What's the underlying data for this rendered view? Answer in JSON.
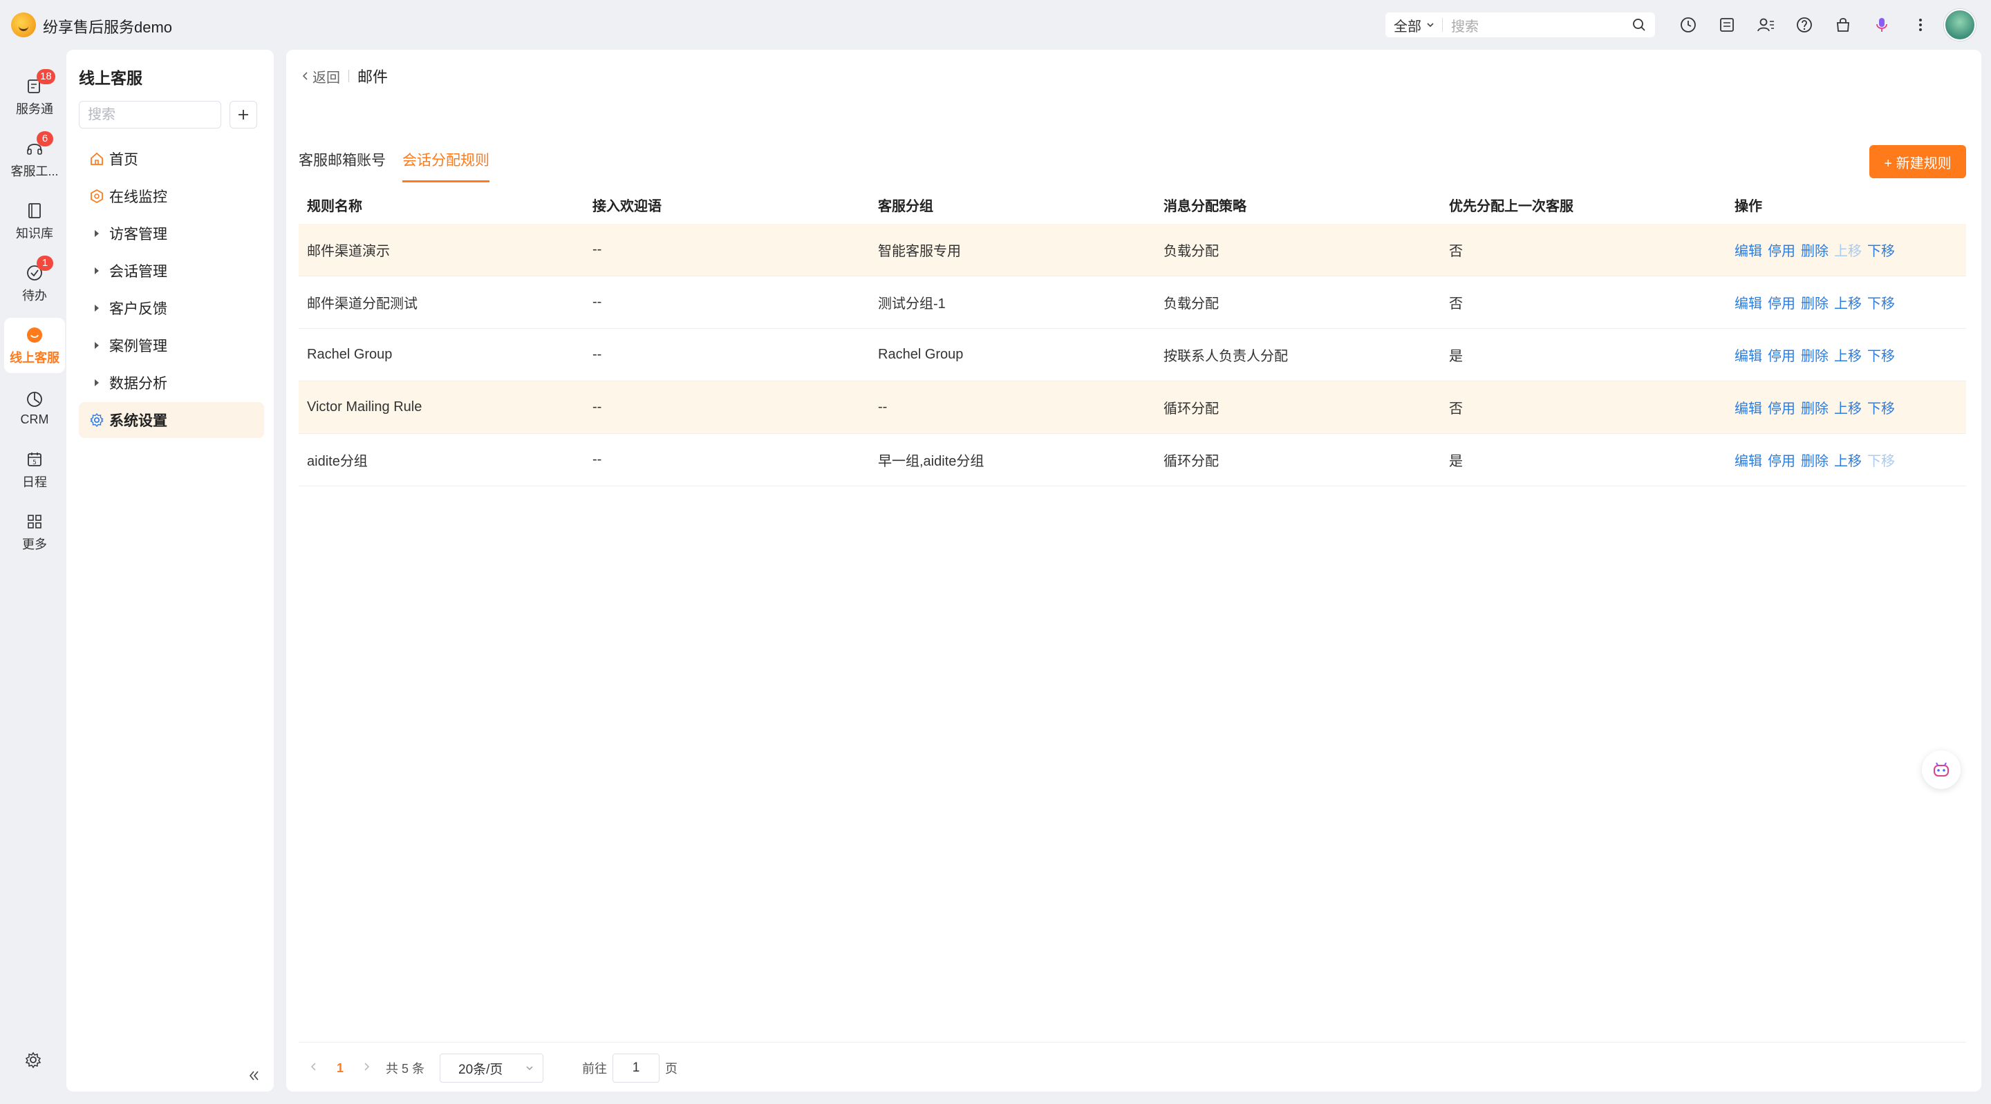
{
  "app": {
    "title": "纷享售后服务demo"
  },
  "topbar": {
    "search_scope": "全部",
    "search_placeholder": "搜索",
    "icons": [
      "clock-icon",
      "inbox-icon",
      "contacts-icon",
      "help-icon",
      "bag-icon",
      "mic-icon",
      "more-icon"
    ]
  },
  "rail": {
    "items": [
      {
        "label": "服务通",
        "badge": "18",
        "icon": "service-icon"
      },
      {
        "label": "客服工...",
        "badge": "6",
        "icon": "headset-icon"
      },
      {
        "label": "知识库",
        "badge": "",
        "icon": "book-icon"
      },
      {
        "label": "待办",
        "badge": "1",
        "icon": "todo-icon"
      },
      {
        "label": "线上客服",
        "badge": "",
        "icon": "online-service-icon",
        "active": true
      },
      {
        "label": "CRM",
        "badge": "",
        "icon": "crm-icon"
      },
      {
        "label": "日程",
        "badge": "",
        "icon": "calendar-icon"
      },
      {
        "label": "更多",
        "badge": "",
        "icon": "grid-icon"
      }
    ]
  },
  "sidebar": {
    "title": "线上客服",
    "search_placeholder": "搜索",
    "menu": [
      {
        "label": "首页",
        "icon": "home-icon"
      },
      {
        "label": "在线监控",
        "icon": "monitor-icon"
      },
      {
        "label": "访客管理",
        "icon": "caret-right-icon"
      },
      {
        "label": "会话管理",
        "icon": "caret-right-icon"
      },
      {
        "label": "客户反馈",
        "icon": "caret-right-icon"
      },
      {
        "label": "案例管理",
        "icon": "caret-right-icon"
      },
      {
        "label": "数据分析",
        "icon": "caret-right-icon"
      },
      {
        "label": "系统设置",
        "icon": "settings-icon",
        "active": true
      }
    ]
  },
  "main": {
    "back_label": "返回",
    "page_title": "邮件",
    "tabs": [
      {
        "label": "客服邮箱账号",
        "active": false
      },
      {
        "label": "会话分配规则",
        "active": true
      }
    ],
    "new_rule_label": "+ 新建规则",
    "table": {
      "headers": [
        "规则名称",
        "接入欢迎语",
        "客服分组",
        "消息分配策略",
        "优先分配上一次客服",
        "操作"
      ],
      "rows": [
        {
          "name": "邮件渠道演示",
          "welcome": "--",
          "group": "智能客服专用",
          "strategy": "负载分配",
          "prev": "否",
          "highlight": true,
          "up_disabled": true,
          "down_disabled": false
        },
        {
          "name": "邮件渠道分配测试",
          "welcome": "--",
          "group": "测试分组-1",
          "strategy": "负载分配",
          "prev": "否",
          "highlight": false,
          "up_disabled": false,
          "down_disabled": false
        },
        {
          "name": "Rachel Group",
          "welcome": "--",
          "group": "Rachel Group",
          "strategy": "按联系人负责人分配",
          "prev": "是",
          "highlight": false,
          "up_disabled": false,
          "down_disabled": false
        },
        {
          "name": "Victor Mailing Rule",
          "welcome": "--",
          "group": "--",
          "strategy": "循环分配",
          "prev": "否",
          "highlight": true,
          "up_disabled": false,
          "down_disabled": false
        },
        {
          "name": "aidite分组",
          "welcome": "--",
          "group": "早一组,aidite分组",
          "strategy": "循环分配",
          "prev": "是",
          "highlight": false,
          "up_disabled": false,
          "down_disabled": true
        }
      ],
      "actions": {
        "edit": "编辑",
        "disable": "停用",
        "delete": "删除",
        "up": "上移",
        "down": "下移"
      }
    },
    "pager": {
      "current_page": "1",
      "total": "共 5 条",
      "page_size": "20条/页",
      "goto_label": "前往",
      "goto_value": "1",
      "page_unit": "页"
    }
  },
  "colors": {
    "accent": "#ff7a1a",
    "link": "#2a7de1",
    "badge": "#f2483e",
    "row_highlight": "#fdf6e9"
  }
}
